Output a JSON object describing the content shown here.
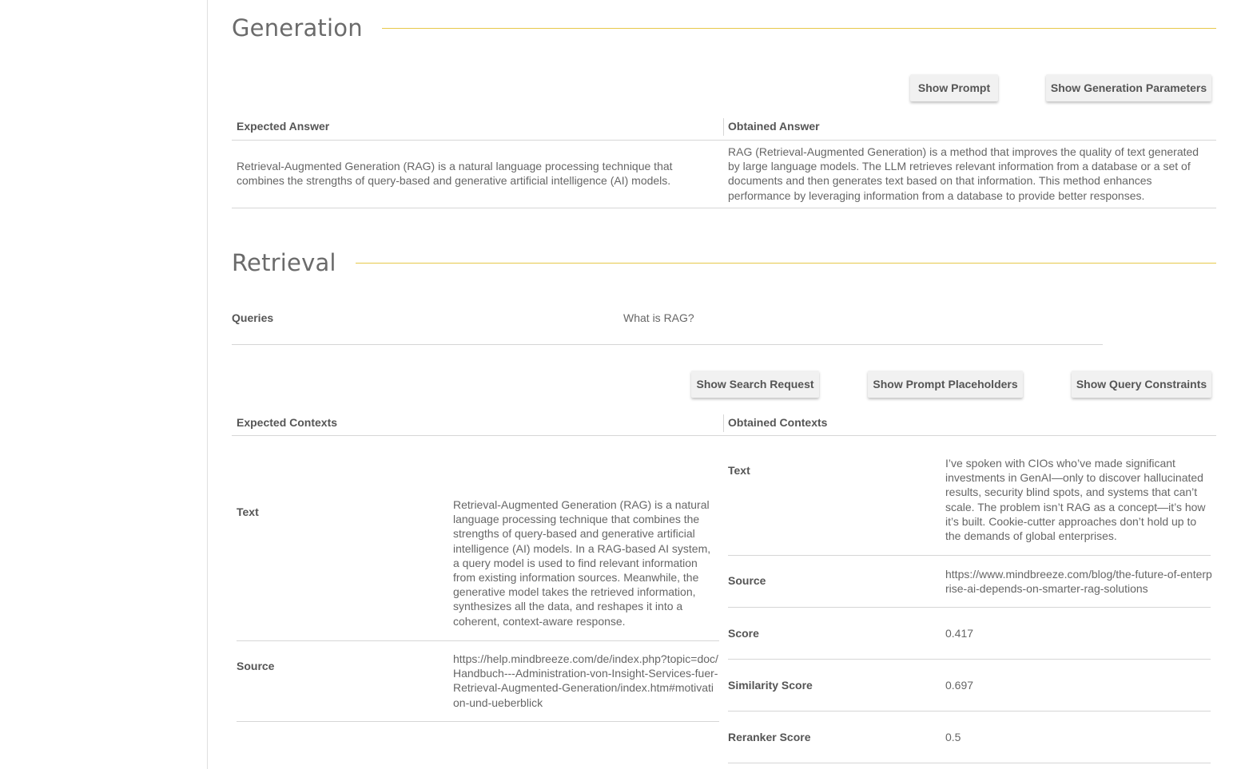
{
  "generation": {
    "title": "Generation",
    "buttons": {
      "show_prompt": "Show Prompt",
      "show_generation_parameters": "Show Generation Parameters"
    },
    "expected_answer_header": "Expected Answer",
    "obtained_answer_header": "Obtained Answer",
    "expected_answer": "Retrieval-Augmented Generation (RAG) is a natural language processing technique that combines the strengths of query-based and generative artificial intelligence (AI) models.",
    "obtained_answer": "RAG (Retrieval-Augmented Generation) is a method that improves the quality of text generated by large language models. The LLM retrieves relevant information from a database or a set of documents and then generates text based on that information. This method enhances performance by leveraging information from a database to provide better responses."
  },
  "retrieval": {
    "title": "Retrieval",
    "queries_label": "Queries",
    "query_value": "What is RAG?",
    "buttons": {
      "show_search_request": "Show Search Request",
      "show_prompt_placeholders": "Show Prompt Placeholders",
      "show_query_constraints": "Show Query Constraints"
    },
    "expected_contexts_header": "Expected Contexts",
    "obtained_contexts_header": "Obtained Contexts",
    "expected": {
      "text_label": "Text",
      "text": "Retrieval-Augmented Generation (RAG) is a natural language processing technique that combines the strengths of query-based and generative artificial intelligence (AI) models. In a RAG-based AI system, a query model is used to find relevant information from existing information sources. Meanwhile, the generative model takes the retrieved information, synthesizes all the data, and reshapes it into a coherent, context-aware response.",
      "source_label": "Source",
      "source": "https://help.mindbreeze.com/de/index.php?topic=doc/Handbuch---Administration-von-Insight-Services-fuer-Retrieval-Augmented-Generation/index.htm#motivation-und-ueberblick"
    },
    "obtained": {
      "text_label": "Text",
      "text": "I’ve spoken with CIOs who’ve made significant investments in GenAI—only to discover hallucinated results, security blind spots, and systems that can’t scale. The problem isn’t RAG as a concept—it’s how it’s built. Cookie-cutter approaches don’t hold up to the demands of global enterprises.",
      "source_label": "Source",
      "source": "https://www.mindbreeze.com/blog/the-future-of-enterprise-ai-depends-on-smarter-rag-solutions",
      "score_label": "Score",
      "score": "0.417",
      "similarity_label": "Similarity Score",
      "similarity": "0.697",
      "reranker_label": "Reranker Score",
      "reranker": "0.5"
    }
  }
}
